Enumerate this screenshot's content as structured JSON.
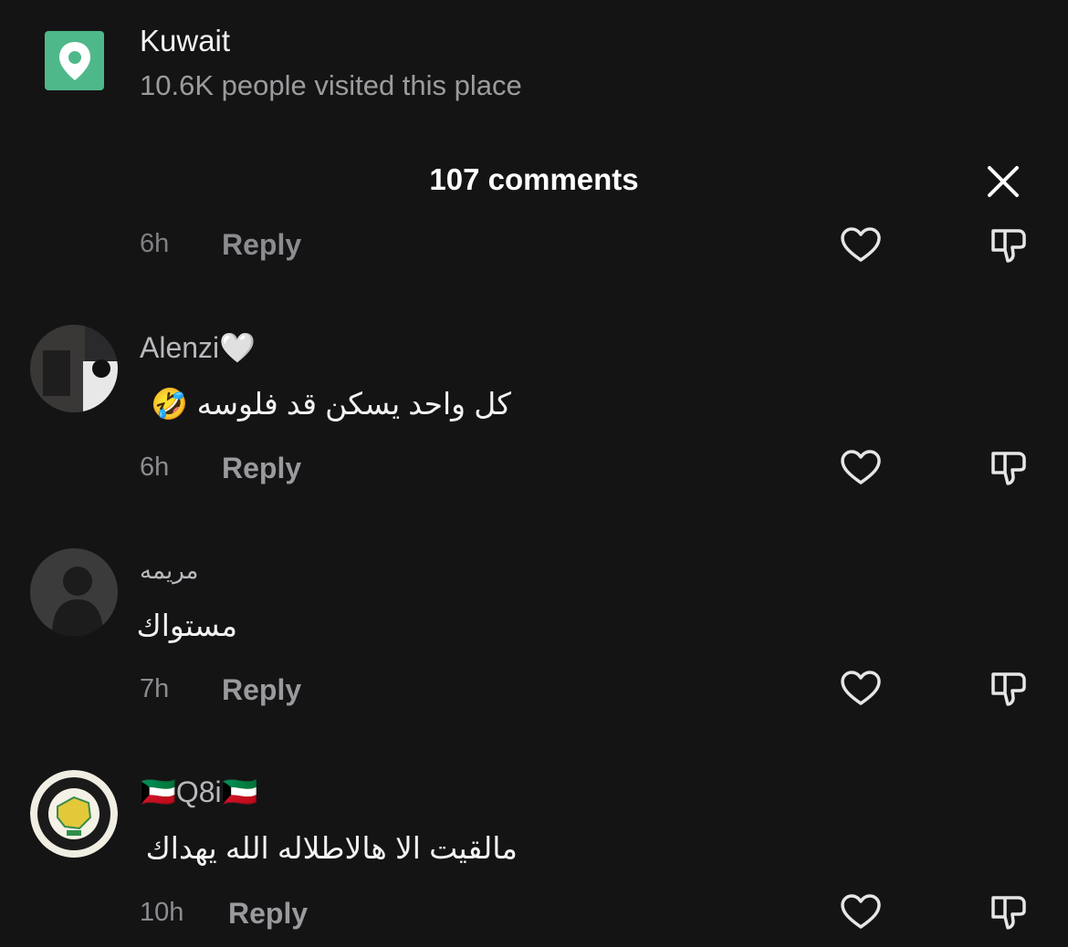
{
  "place": {
    "name": "Kuwait",
    "visitors": "10.6K people visited this place"
  },
  "header": {
    "comment_count": "107 comments"
  },
  "reply_label": "Reply",
  "partial_comment": {
    "time": "6h"
  },
  "comments": [
    {
      "username": "Alenzi🤍",
      "text": "كل واحد يسكن قد فلوسه 🤣",
      "time": "6h"
    },
    {
      "username": "مريمه",
      "text": "مستواك",
      "time": "7h"
    },
    {
      "username": "🇰🇼Q8i🇰🇼",
      "text": "مالقيت الا هالاطلاله الله يهداك",
      "time": "10h"
    }
  ],
  "colors": {
    "background": "#141415",
    "place_icon": "#4fb88a",
    "secondary_text": "#9c9c9f"
  }
}
